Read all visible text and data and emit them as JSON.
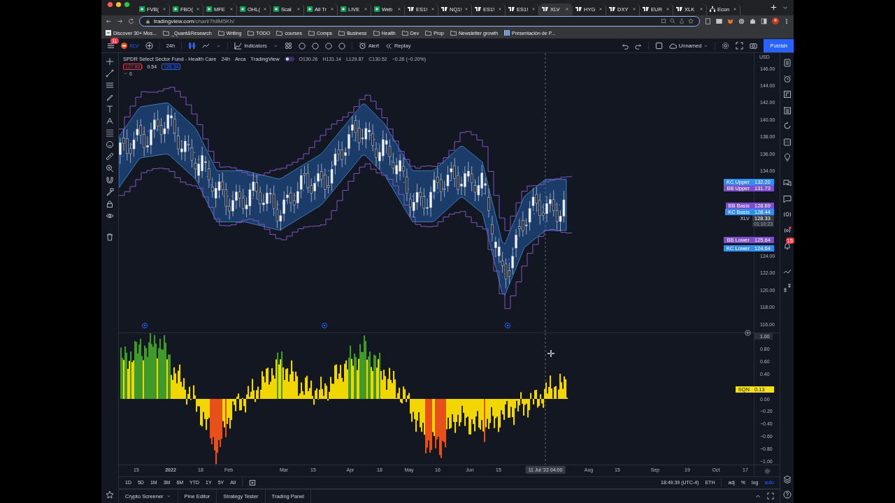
{
  "browser": {
    "tabs": [
      {
        "label": "FVB(",
        "kind": "sheet",
        "selected": false
      },
      {
        "label": "FBO(",
        "kind": "sheet",
        "selected": false
      },
      {
        "label": "MFE",
        "kind": "sheet",
        "selected": false
      },
      {
        "label": "OHL(",
        "kind": "sheet",
        "selected": false
      },
      {
        "label": "Scal",
        "kind": "sheet",
        "selected": false
      },
      {
        "label": "All Tr",
        "kind": "sheet",
        "selected": false
      },
      {
        "label": "LIVE",
        "kind": "sheet",
        "selected": false
      },
      {
        "label": "Web",
        "kind": "sheet",
        "selected": false
      },
      {
        "label": "ES1!",
        "kind": "site",
        "selected": false
      },
      {
        "label": "NQ1!",
        "kind": "site",
        "selected": false
      },
      {
        "label": "ES1!",
        "kind": "site",
        "selected": false
      },
      {
        "label": "ES1!",
        "kind": "site",
        "selected": false
      },
      {
        "label": "XLV",
        "kind": "site",
        "selected": true
      },
      {
        "label": "HYG",
        "kind": "site",
        "selected": false
      },
      {
        "label": "DXY",
        "kind": "site",
        "selected": false
      },
      {
        "label": "EUR",
        "kind": "site",
        "selected": false
      },
      {
        "label": "XLK",
        "kind": "site",
        "selected": false
      },
      {
        "label": "Econ",
        "kind": "sitemap",
        "selected": false
      }
    ],
    "url": {
      "domain": "tradingview.com",
      "path": "/chart/7hllM5Kh/"
    },
    "bookmarks": [
      {
        "label": "Discover 30+ Mos...",
        "kind": "page"
      },
      {
        "label": "_Quant&Research",
        "kind": "folder"
      },
      {
        "label": "Writing",
        "kind": "folder"
      },
      {
        "label": "TODO",
        "kind": "folder"
      },
      {
        "label": "courses",
        "kind": "folder"
      },
      {
        "label": "Comps",
        "kind": "folder"
      },
      {
        "label": "Business",
        "kind": "folder"
      },
      {
        "label": "Health",
        "kind": "folder"
      },
      {
        "label": "Dev",
        "kind": "folder"
      },
      {
        "label": "Prop",
        "kind": "folder"
      },
      {
        "label": "Newsletter growth",
        "kind": "folder"
      },
      {
        "label": "Presentación de P...",
        "kind": "doc"
      }
    ]
  },
  "toolbar": {
    "menu_badge": "11",
    "symbol": "XLV",
    "interval": "24h",
    "indicators": "Indicators",
    "alert": "Alert",
    "replay": "Replay",
    "layout_name": "Unnamed",
    "publish": "Publish"
  },
  "legend": {
    "title": "SPDR Select Sector Fund - Health Care",
    "interval": "24h",
    "exchange": "Arca",
    "source": "TradingView",
    "ohlc": [
      "O130.26",
      "H131.14",
      "L129.87",
      "C130.52",
      "−0.26 (−0.20%)"
    ],
    "bid": "127.80",
    "spread": "0.54",
    "ask": "128.34",
    "indicator_count": "6"
  },
  "price_axis": {
    "currency": "USD",
    "labels": [
      "146.00",
      "144.00",
      "142.00",
      "140.00",
      "138.00",
      "136.00",
      "134.00",
      "124.00",
      "122.00",
      "120.00",
      "118.00",
      "116.00"
    ]
  },
  "price_badges": [
    {
      "name": "KC Upper",
      "value": "132.20",
      "kind": "indicator",
      "color": "#2f8ff0"
    },
    {
      "name": "BB Upper",
      "value": "131.73",
      "kind": "indicator",
      "color": "#7c4dcc"
    },
    {
      "name": "BB Basis",
      "value": "128.69",
      "kind": "indicator",
      "color": "#7c4dcc"
    },
    {
      "name": "KC Basis",
      "value": "128.44",
      "kind": "indicator",
      "color": "#2f8ff0"
    },
    {
      "name": "XLV",
      "value": "128.33",
      "countdown": "01:10:23",
      "kind": "symbol",
      "color": "#363a45"
    },
    {
      "name": "BB Lower",
      "value": "125.64",
      "kind": "indicator",
      "color": "#7c4dcc"
    },
    {
      "name": "KC Lower",
      "value": "124.64",
      "kind": "indicator",
      "color": "#2f8ff0"
    }
  ],
  "oscillator_axis": {
    "labels": [
      "1.00",
      "0.80",
      "0.60",
      "0.40",
      "0.00",
      "−0.20",
      "−0.40",
      "−0.60",
      "−0.80",
      "−1.00"
    ]
  },
  "oscillator_badge": {
    "name": "SQN",
    "value": "0.13",
    "color": "#f5e11a"
  },
  "time_axis": {
    "labels": [
      "15",
      "2022",
      "18",
      "Feb",
      "Mar",
      "15",
      "Apr",
      "18",
      "May",
      "16",
      "Jun",
      "15",
      "Aug",
      "15",
      "Sep",
      "19",
      "Oct",
      "17"
    ],
    "crosshair": "11 Jul '22  04:00"
  },
  "range_buttons": [
    "1D",
    "5D",
    "1M",
    "3M",
    "6M",
    "YTD",
    "1Y",
    "5Y",
    "All"
  ],
  "clock": "18:49:39 (UTC-4)",
  "session": "ETH",
  "scale_options": [
    {
      "label": "adj",
      "selected": false
    },
    {
      "label": "%",
      "selected": false
    },
    {
      "label": "log",
      "selected": false
    },
    {
      "label": "auto",
      "selected": true
    }
  ],
  "bottom_tabs": [
    {
      "label": "Crypto Screener",
      "dropdown": true
    },
    {
      "label": "Pine Editor",
      "dropdown": false
    },
    {
      "label": "Strategy Tester",
      "dropdown": false
    },
    {
      "label": "Trading Panel",
      "dropdown": false
    }
  ],
  "notification_badge": "15"
}
